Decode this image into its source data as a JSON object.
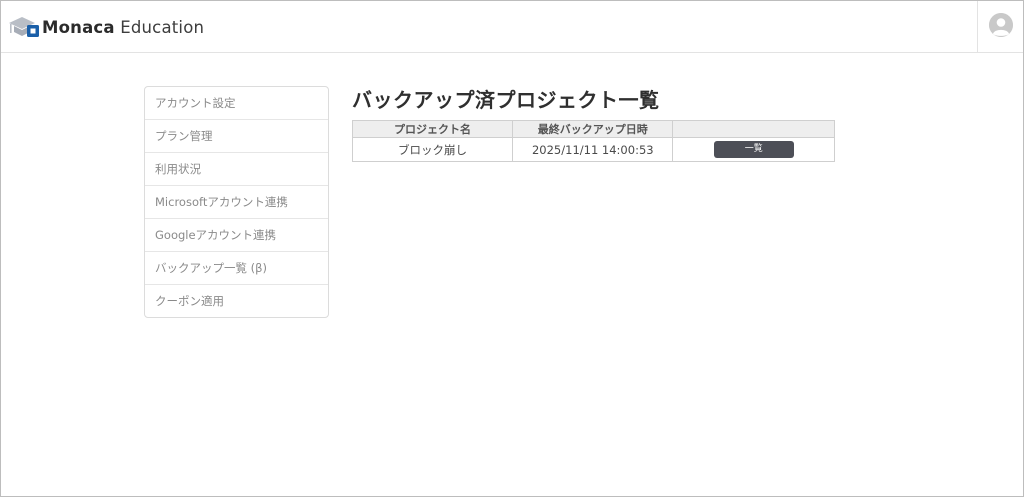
{
  "header": {
    "brand_name": "Monaca",
    "brand_suffix": "Education",
    "logo_icon": "graduation-cap-icon",
    "avatar_icon": "user-avatar-icon"
  },
  "sidebar": {
    "items": [
      {
        "label": "アカウント設定"
      },
      {
        "label": "プラン管理"
      },
      {
        "label": "利用状況"
      },
      {
        "label": "Microsoftアカウント連携"
      },
      {
        "label": "Googleアカウント連携"
      },
      {
        "label": "バックアップ一覧 (β)"
      },
      {
        "label": "クーポン適用"
      }
    ]
  },
  "main": {
    "title": "バックアップ済プロジェクト一覧",
    "table": {
      "headers": [
        "プロジェクト名",
        "最終バックアップ日時",
        ""
      ],
      "rows": [
        {
          "project": "ブロック崩し",
          "last_backup": "2025/11/11 14:00:53",
          "action_label": "一覧"
        }
      ]
    }
  },
  "colors": {
    "accent": "#1a5fa8",
    "button": "#4d4f57",
    "table_header": "#eeeeee",
    "sidebar_text": "#8a8a8a"
  }
}
